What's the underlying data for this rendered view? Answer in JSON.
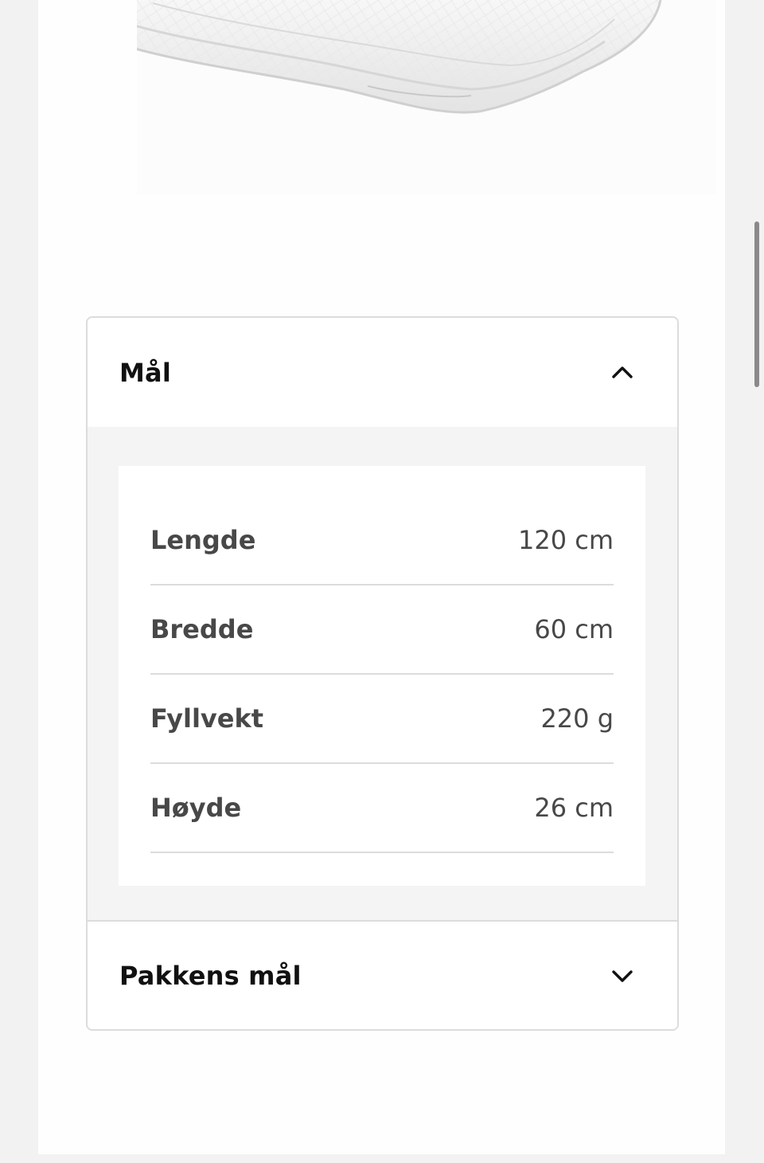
{
  "product_image": {
    "icon": "folded-duvet-image",
    "alt": ""
  },
  "accordion": {
    "sections": [
      {
        "title": "Mål",
        "expanded": true,
        "chevron": "chevron-up-icon",
        "rows": [
          {
            "label": "Lengde",
            "value": "120 cm"
          },
          {
            "label": "Bredde",
            "value": "60 cm"
          },
          {
            "label": "Fyllvekt",
            "value": "220 g"
          },
          {
            "label": "Høyde",
            "value": "26 cm"
          }
        ]
      },
      {
        "title": "Pakkens mål",
        "expanded": false,
        "chevron": "chevron-down-icon"
      }
    ]
  },
  "colors": {
    "page_background": "#f2f2f2",
    "panel_background": "#f4f4f4",
    "divider": "#dcdcdc",
    "text_primary": "#111111",
    "text_secondary": "#484848"
  }
}
